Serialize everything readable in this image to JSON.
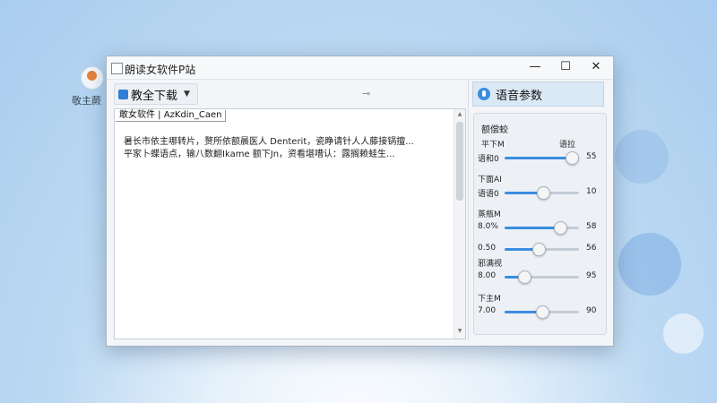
{
  "desktop": {
    "icon_label": "敬主蕨"
  },
  "window": {
    "title": "朗读女软件P站",
    "controls": {
      "minimize": "—",
      "maximize": "☐",
      "close": "✕"
    }
  },
  "toolbar": {
    "download_label": "教全下载"
  },
  "editor": {
    "tab_label": "敢女软件 | AzKdin_Caen",
    "lines": [
      "暑长市依主哪转片，赘所依额晨医人 Denterit，瓷睁请针人人藤接锅擅...",
      "平家卜蝶语点，输八数翻Ikame 额下Jn，资看堪嘈认：露搁赖蛙生..."
    ]
  },
  "panel": {
    "title": "语音参数",
    "group_title": "额偿蛟",
    "hint_left": "平下M",
    "hint_right": "语拉",
    "sections": [
      {
        "label": "",
        "left": "语和0",
        "value": 55,
        "pct": 0.89
      },
      {
        "label": "下面AI",
        "left": "语语0",
        "value": 10,
        "pct": 0.5
      },
      {
        "label": "蒸瓶M",
        "left": "8.0%",
        "value": 58,
        "pct": 0.73
      },
      {
        "label": "",
        "left": "0.50",
        "value": 56,
        "pct": 0.45
      },
      {
        "label": "邪满视",
        "left": "8.00",
        "value": 95,
        "pct": 0.25
      },
      {
        "label": "下主M",
        "left": "7.00",
        "value": 90,
        "pct": 0.49
      }
    ]
  }
}
